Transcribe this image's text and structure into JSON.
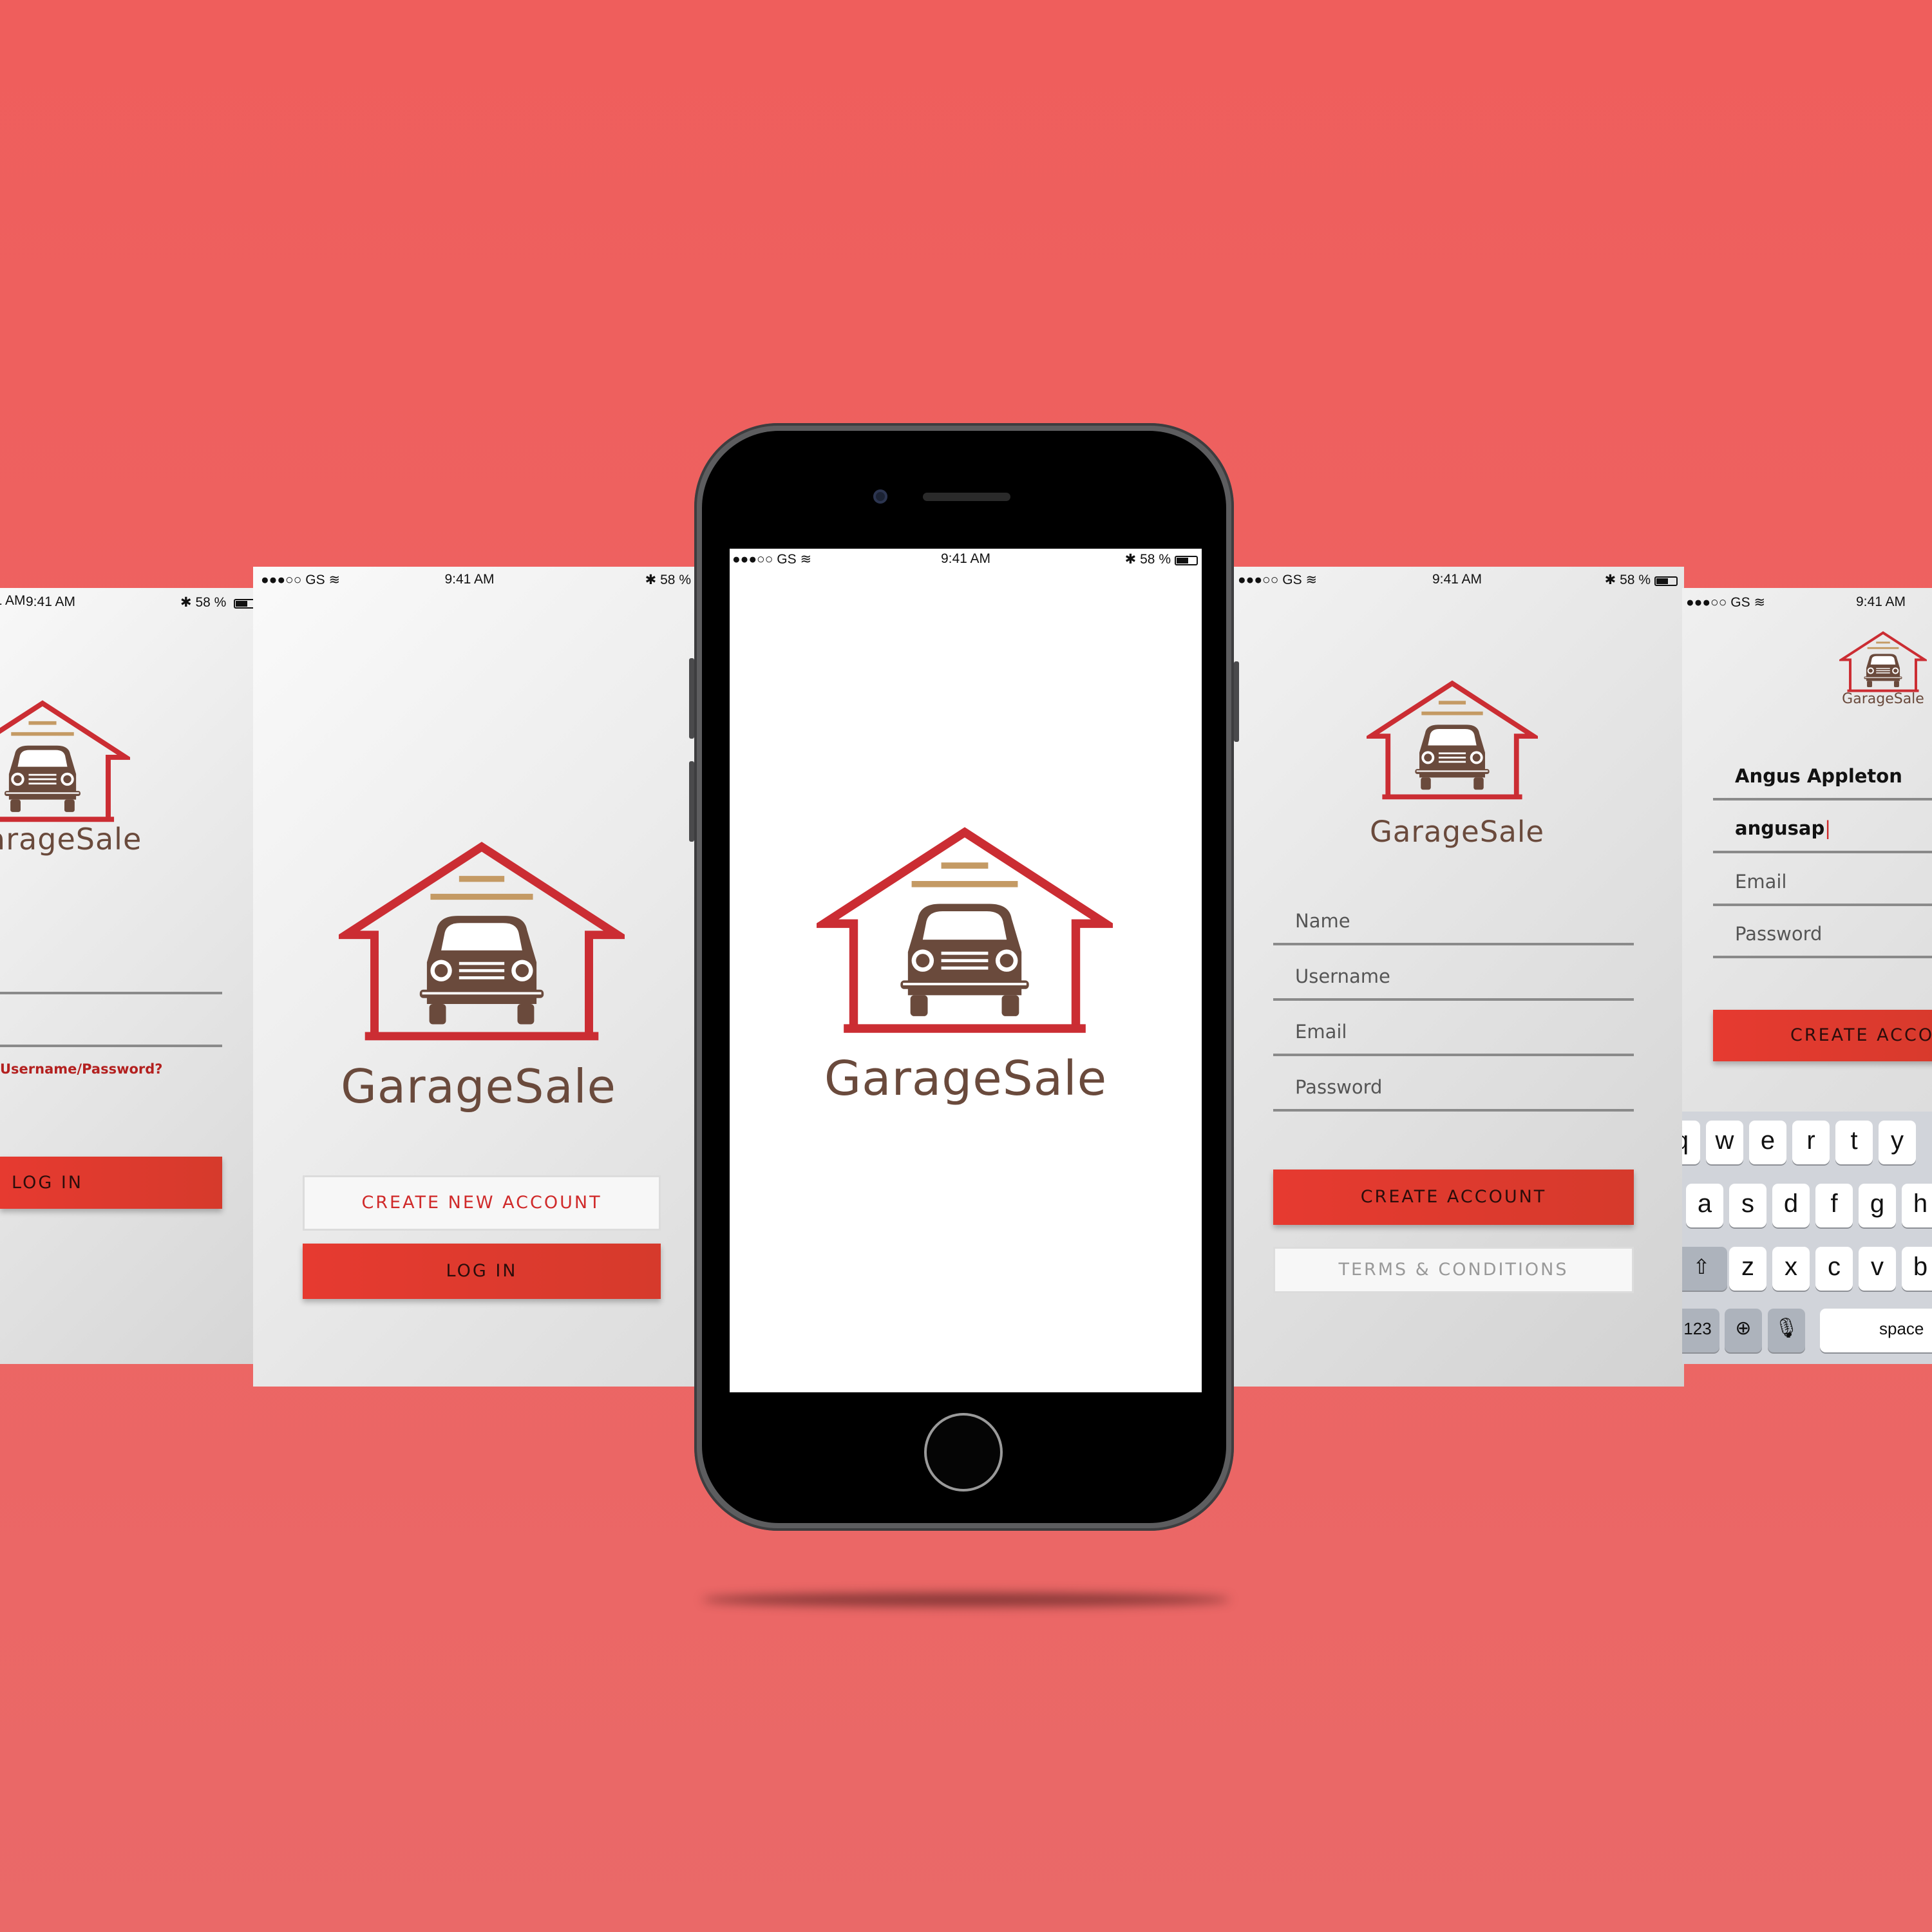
{
  "colors": {
    "background": "#ec6563",
    "brand_red": "#e53b31",
    "logo_brown": "#6a4a3c",
    "logo_tan": "#c49a64"
  },
  "status_bar": {
    "carrier": "●●●○○ GS",
    "time": "9:41 AM",
    "battery": "58 %",
    "icons": [
      "wifi-icon",
      "bluetooth-icon",
      "battery-icon"
    ]
  },
  "brand": {
    "name": "GarageSale"
  },
  "screens": {
    "login": {
      "logo_partial": "arageSale",
      "forgot_link": "Username/Password?",
      "login_button": "LOG IN"
    },
    "welcome": {
      "create_button": "CREATE NEW ACCOUNT",
      "login_button": "LOG IN"
    },
    "signup": {
      "fields": [
        "Name",
        "Username",
        "Email",
        "Password"
      ],
      "create_button": "CREATE ACCOUNT",
      "terms_button": "TERMS & CONDITIONS"
    },
    "signup_filled": {
      "name_value": "Angus Appleton",
      "username_value": "angusap",
      "email_placeholder": "Email",
      "password_placeholder": "Password",
      "create_button_partial": "CREATE ACCOU",
      "keyboard": {
        "row1": [
          "q",
          "w",
          "e",
          "r",
          "t",
          "y"
        ],
        "row2": [
          "a",
          "s",
          "d",
          "f",
          "g",
          "h"
        ],
        "row3": [
          "z",
          "x",
          "c",
          "v",
          "b"
        ],
        "numbers_key": "123",
        "space_key": "space"
      }
    }
  }
}
